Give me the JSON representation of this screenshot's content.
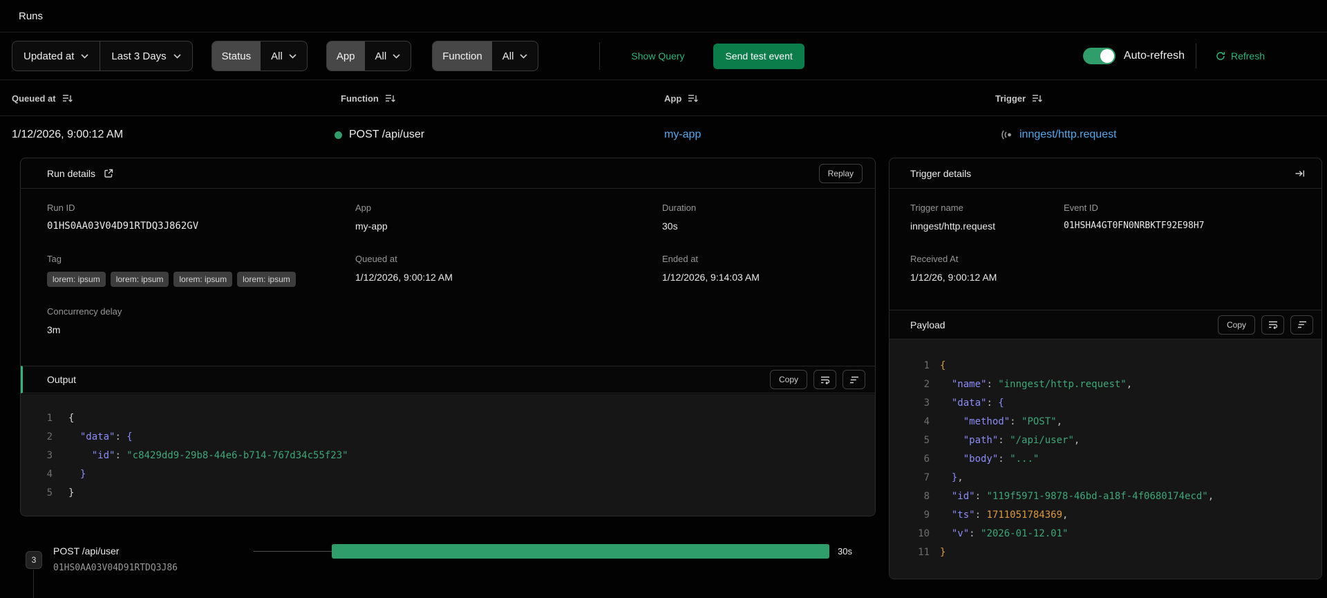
{
  "page": {
    "title": "Runs"
  },
  "filterbar": {
    "sort_field": "Updated at",
    "time_range": "Last 3 Days",
    "status_label": "Status",
    "status_value": "All",
    "app_label": "App",
    "app_value": "All",
    "function_label": "Function",
    "function_value": "All",
    "show_query": "Show Query",
    "send_test_event": "Send test event",
    "auto_refresh": "Auto-refresh",
    "auto_refresh_on": true,
    "refresh": "Refresh"
  },
  "table": {
    "columns": {
      "queued_at": "Queued at",
      "function": "Function",
      "app": "App",
      "trigger": "Trigger"
    },
    "row": {
      "queued_at": "1/12/2026, 9:00:12 AM",
      "function": "POST /api/user",
      "status_color": "#2f9e6b",
      "app": "my-app",
      "trigger": "inngest/http.request"
    }
  },
  "run_details": {
    "title": "Run details",
    "replay": "Replay",
    "run_id_label": "Run ID",
    "run_id": "01HS0AA03V04D91RTDQ3J862GV",
    "app_label": "App",
    "app": "my-app",
    "duration_label": "Duration",
    "duration": "30s",
    "tag_label": "Tag",
    "tags": [
      "lorem: ipsum",
      "lorem: ipsum",
      "lorem: ipsum",
      "lorem: ipsum"
    ],
    "queued_at_label": "Queued at",
    "queued_at": "1/12/2026, 9:00:12 AM",
    "ended_at_label": "Ended at",
    "ended_at": "1/12/2026, 9:14:03 AM",
    "concurrency_label": "Concurrency delay",
    "concurrency": "3m",
    "output": {
      "title": "Output",
      "copy": "Copy",
      "lines": [
        [
          [
            "w",
            "{"
          ]
        ],
        [
          [
            "p",
            "  "
          ],
          [
            "k",
            "\"data\""
          ],
          [
            "p",
            ": "
          ],
          [
            "b1",
            "{"
          ]
        ],
        [
          [
            "p",
            "    "
          ],
          [
            "k",
            "\"id\""
          ],
          [
            "p",
            ": "
          ],
          [
            "s",
            "\"c8429dd9-29b8-44e6-b714-767d34c55f23\""
          ]
        ],
        [
          [
            "p",
            "  "
          ],
          [
            "b1",
            "}"
          ]
        ],
        [
          [
            "w",
            "}"
          ]
        ]
      ]
    }
  },
  "trigger_details": {
    "title": "Trigger details",
    "trigger_name_label": "Trigger name",
    "trigger_name": "inngest/http.request",
    "event_id_label": "Event ID",
    "event_id": "01HSHA4GT0FN0NRBKTF92E98H7",
    "received_at_label": "Received At",
    "received_at": "1/12/26, 9:00:12 AM",
    "payload": {
      "title": "Payload",
      "copy": "Copy",
      "lines": [
        [
          [
            "b0",
            "{"
          ]
        ],
        [
          [
            "p",
            "  "
          ],
          [
            "k",
            "\"name\""
          ],
          [
            "p",
            ": "
          ],
          [
            "s",
            "\"inngest/http.request\""
          ],
          [
            "p",
            ","
          ]
        ],
        [
          [
            "p",
            "  "
          ],
          [
            "k",
            "\"data\""
          ],
          [
            "p",
            ": "
          ],
          [
            "b1",
            "{"
          ]
        ],
        [
          [
            "p",
            "    "
          ],
          [
            "k",
            "\"method\""
          ],
          [
            "p",
            ": "
          ],
          [
            "s",
            "\"POST\""
          ],
          [
            "p",
            ","
          ]
        ],
        [
          [
            "p",
            "    "
          ],
          [
            "k",
            "\"path\""
          ],
          [
            "p",
            ": "
          ],
          [
            "s",
            "\"/api/user\""
          ],
          [
            "p",
            ","
          ]
        ],
        [
          [
            "p",
            "    "
          ],
          [
            "k",
            "\"body\""
          ],
          [
            "p",
            ": "
          ],
          [
            "s",
            "\"...\""
          ]
        ],
        [
          [
            "p",
            "  "
          ],
          [
            "b1",
            "}"
          ],
          [
            "p",
            ","
          ]
        ],
        [
          [
            "p",
            "  "
          ],
          [
            "k",
            "\"id\""
          ],
          [
            "p",
            ": "
          ],
          [
            "s",
            "\"119f5971-9878-46bd-a18f-4f0680174ecd\""
          ],
          [
            "p",
            ","
          ]
        ],
        [
          [
            "p",
            "  "
          ],
          [
            "k",
            "\"ts\""
          ],
          [
            "p",
            ": "
          ],
          [
            "n",
            "1711051784369"
          ],
          [
            "p",
            ","
          ]
        ],
        [
          [
            "p",
            "  "
          ],
          [
            "k",
            "\"v\""
          ],
          [
            "p",
            ": "
          ],
          [
            "s",
            "\"2026-01-12.01\""
          ]
        ],
        [
          [
            "b0",
            "}"
          ]
        ]
      ]
    }
  },
  "timeline": {
    "badge": "3",
    "function": "POST /api/user",
    "run_id": "01HS0AA03V04D91RTDQ3J86",
    "duration": "30s"
  }
}
